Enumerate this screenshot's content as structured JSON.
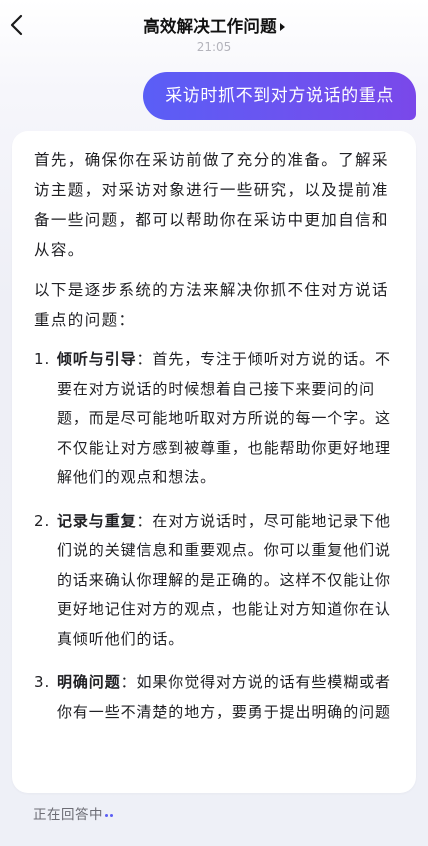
{
  "header": {
    "title": "高效解决工作问题"
  },
  "timestamp": "21:05",
  "user_message": "采访时抓不到对方说话的重点",
  "answer": {
    "intro": "首先，确保你在采访前做了充分的准备。了解采访主题，对采访对象进行一些研究，以及提前准备一些问题，都可以帮助你在采访中更加自信和从容。",
    "lead": "以下是逐步系统的方法来解决你抓不住对方说话重点的问题：",
    "items": [
      {
        "num": "1.",
        "title": "倾听与引导",
        "body": "：首先，专注于倾听对方说的话。不要在对方说话的时候想着自己接下来要问的问题，而是尽可能地听取对方所说的每一个字。这不仅能让对方感到被尊重，也能帮助你更好地理解他们的观点和想法。"
      },
      {
        "num": "2.",
        "title": "记录与重复",
        "body": "：在对方说话时，尽可能地记录下他们说的关键信息和重要观点。你可以重复他们说的话来确认你理解的是正确的。这样不仅能让你更好地记住对方的观点，也能让对方知道你在认真倾听他们的话。"
      },
      {
        "num": "3.",
        "title": "明确问题",
        "body": "：如果你觉得对方说的话有些模糊或者你有一些不清楚的地方，要勇于提出明确的问题"
      }
    ]
  },
  "status": {
    "label": "正在回答中"
  },
  "colors": {
    "accent": "#5b5ef5",
    "bubble_gradient_start": "#5a5ef6",
    "bubble_gradient_end": "#7a48ea"
  },
  "icons": {
    "back": "chevron-left-icon",
    "title_caret": "caret-right-icon"
  }
}
